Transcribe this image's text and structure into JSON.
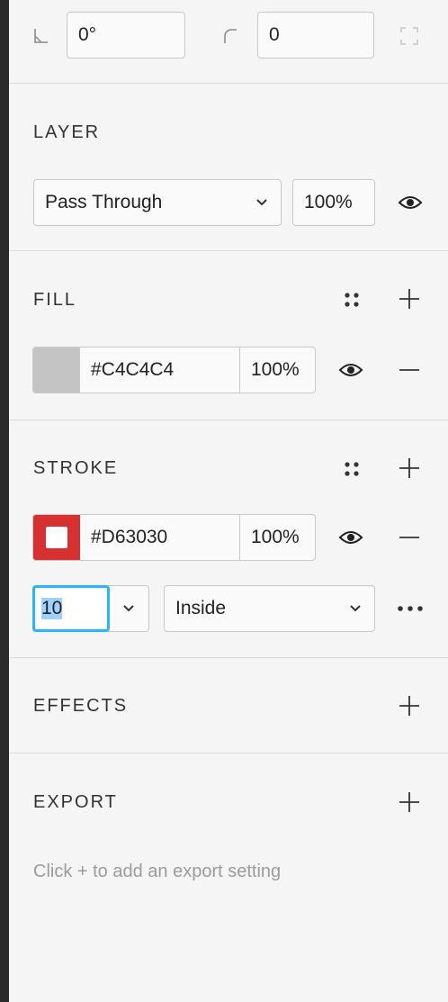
{
  "transform": {
    "rotation_value": "0°",
    "corner_radius_value": "0"
  },
  "layer": {
    "title": "LAYER",
    "blend_mode": "Pass Through",
    "opacity": "100%"
  },
  "fill": {
    "title": "FILL",
    "swatch_color": "#C4C4C4",
    "hex": "#C4C4C4",
    "opacity": "100%"
  },
  "stroke": {
    "title": "STROKE",
    "swatch_color": "#D63030",
    "hex": "#D63030",
    "opacity": "100%",
    "weight": "10",
    "position": "Inside"
  },
  "effects": {
    "title": "EFFECTS"
  },
  "export": {
    "title": "EXPORT",
    "hint": "Click + to add an export setting"
  },
  "colors": {
    "accent_focus": "#29b6f6",
    "selection_bg": "#9fd0ff"
  },
  "icons": [
    "angle-icon",
    "corner-radius-icon",
    "independent-corners-icon",
    "eye-icon",
    "style-grid-icon",
    "plus-icon",
    "minus-icon",
    "chevron-down-icon",
    "more-icon"
  ]
}
